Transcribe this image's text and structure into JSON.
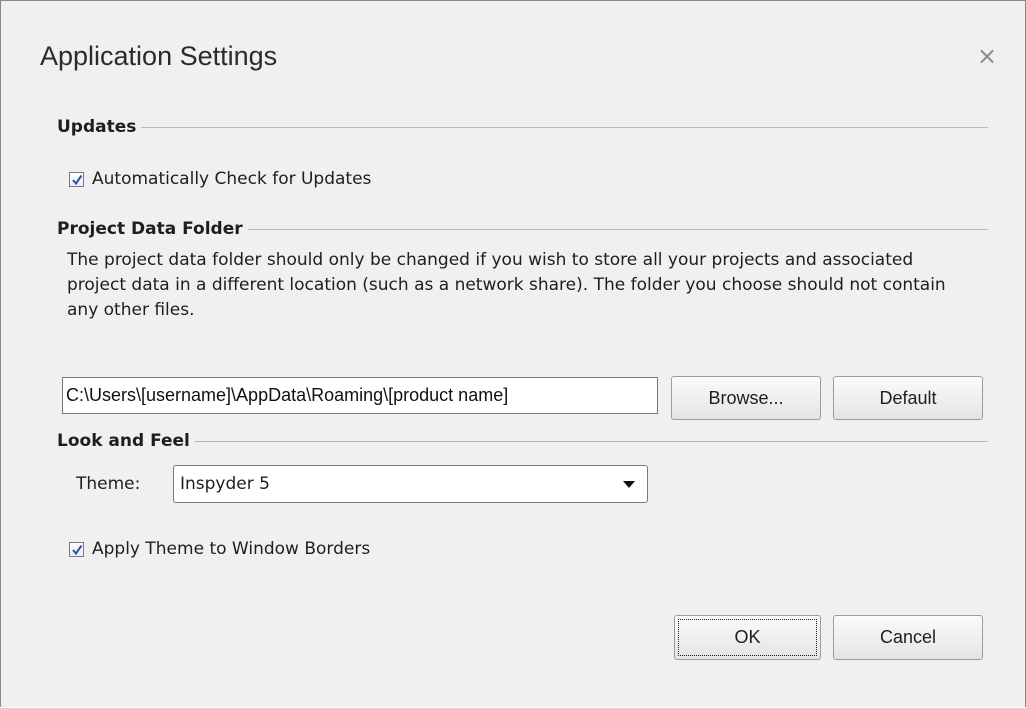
{
  "dialog": {
    "title": "Application Settings",
    "close_glyph": "×"
  },
  "updates": {
    "header": "Updates",
    "auto_check": {
      "label": "Automatically Check for Updates",
      "checked": true
    }
  },
  "project_data": {
    "header": "Project Data Folder",
    "description": "The project data folder should only be changed if you wish to store all your projects and associated project data in a different location (such as a network share). The folder you choose should not contain any other files.",
    "path_value": "C:\\Users\\[username]\\AppData\\Roaming\\[product name]",
    "browse_label": "Browse...",
    "default_label": "Default"
  },
  "look_and_feel": {
    "header": "Look and Feel",
    "theme_label": "Theme:",
    "theme_value": "Inspyder 5",
    "apply_borders": {
      "label": "Apply Theme to Window Borders",
      "checked": true
    }
  },
  "footer": {
    "ok_label": "OK",
    "cancel_label": "Cancel"
  },
  "colors": {
    "check_mark": "#2f4fa8",
    "dialog_bg": "#f0f0f0"
  }
}
